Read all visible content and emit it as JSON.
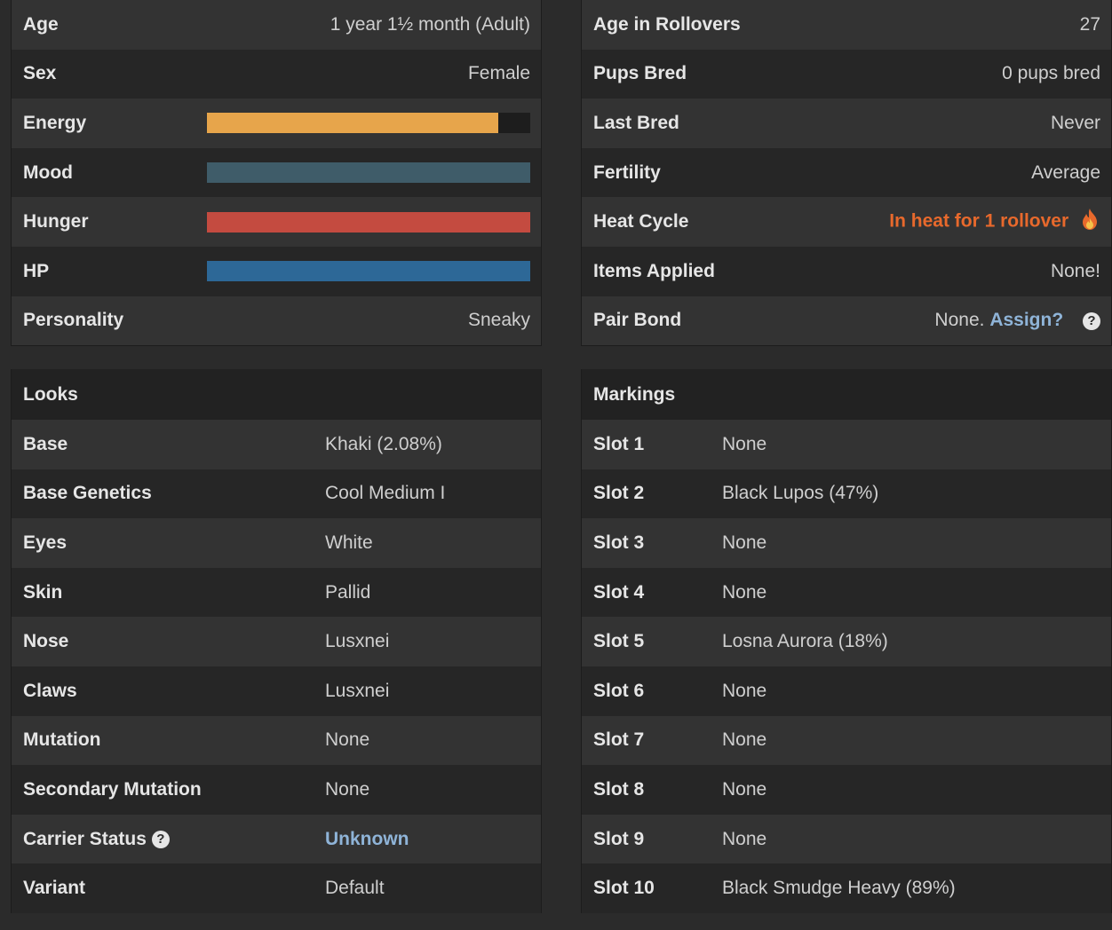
{
  "stats_left": [
    {
      "label": "Age",
      "value": "1 year 1½ month (Adult)"
    },
    {
      "label": "Sex",
      "value": "Female"
    },
    {
      "label": "Energy",
      "bar": 0.9,
      "color": "#e7a54b"
    },
    {
      "label": "Mood",
      "bar": 1.0,
      "color": "#3f5c69"
    },
    {
      "label": "Hunger",
      "bar": 1.0,
      "color": "#c44b40"
    },
    {
      "label": "HP",
      "bar": 1.0,
      "color": "#2d6897"
    },
    {
      "label": "Personality",
      "value": "Sneaky"
    }
  ],
  "stats_right": {
    "age_rollovers": {
      "label": "Age in Rollovers",
      "value": "27"
    },
    "pups_bred": {
      "label": "Pups Bred",
      "value": "0 pups bred"
    },
    "last_bred": {
      "label": "Last Bred",
      "value": "Never"
    },
    "fertility": {
      "label": "Fertility",
      "value": "Average"
    },
    "heat_cycle": {
      "label": "Heat Cycle",
      "value": "In heat for 1 rollover",
      "icon": "fire-icon"
    },
    "items_applied": {
      "label": "Items Applied",
      "value": "None!"
    },
    "pair_bond": {
      "label": "Pair Bond",
      "value": "None.",
      "link": "Assign?",
      "icon": "question-circle-icon"
    }
  },
  "looks": {
    "title": "Looks",
    "rows": [
      {
        "label": "Base",
        "value": "Khaki (2.08%)"
      },
      {
        "label": "Base Genetics",
        "value": "Cool Medium I"
      },
      {
        "label": "Eyes",
        "value": "White"
      },
      {
        "label": "Skin",
        "value": "Pallid"
      },
      {
        "label": "Nose",
        "value": "Lusxnei"
      },
      {
        "label": "Claws",
        "value": "Lusxnei"
      },
      {
        "label": "Mutation",
        "value": "None"
      },
      {
        "label": "Secondary Mutation",
        "value": "None"
      },
      {
        "label": "Carrier Status",
        "value": "Unknown",
        "icon": "question-circle-icon",
        "link": true
      },
      {
        "label": "Variant",
        "value": "Default"
      }
    ]
  },
  "markings": {
    "title": "Markings",
    "rows": [
      {
        "label": "Slot 1",
        "value": "None"
      },
      {
        "label": "Slot 2",
        "value": "Black Lupos (47%)"
      },
      {
        "label": "Slot 3",
        "value": "None"
      },
      {
        "label": "Slot 4",
        "value": "None"
      },
      {
        "label": "Slot 5",
        "value": "Losna Aurora (18%)"
      },
      {
        "label": "Slot 6",
        "value": "None"
      },
      {
        "label": "Slot 7",
        "value": "None"
      },
      {
        "label": "Slot 8",
        "value": "None"
      },
      {
        "label": "Slot 9",
        "value": "None"
      },
      {
        "label": "Slot 10",
        "value": "Black Smudge Heavy (89%)"
      }
    ]
  }
}
